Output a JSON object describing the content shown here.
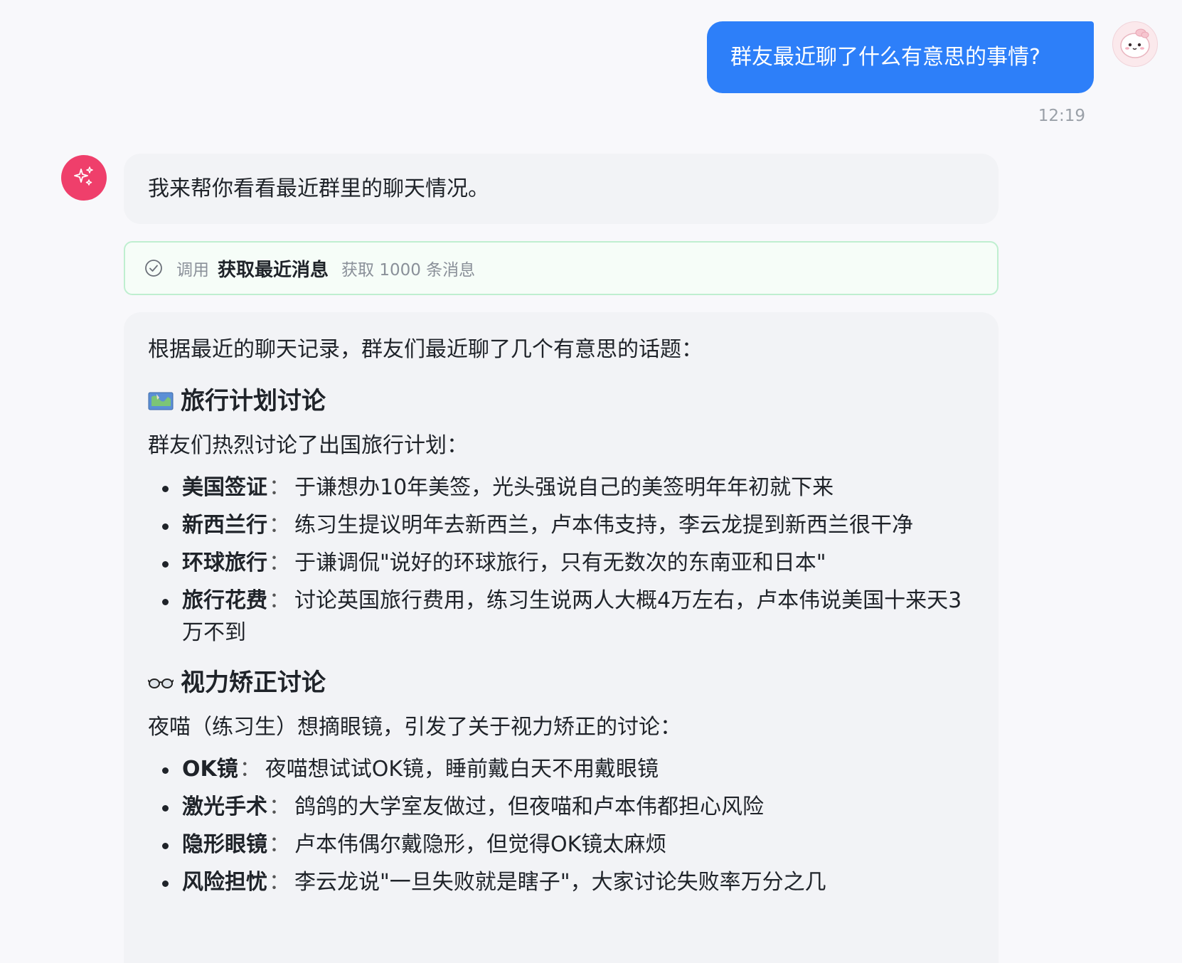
{
  "user_message": {
    "text": "群友最近聊了什么有意思的事情?",
    "time": "12:19",
    "avatar_icon": "bunny-avatar-icon"
  },
  "assistant": {
    "avatar_icon": "sparkle-icon",
    "first_reply": "我来帮你看看最近群里的聊天情况。",
    "tool_call": {
      "status_icon": "check-circle-icon",
      "call_label": "调用",
      "tool_name": "获取最近消息",
      "description": "获取 1000 条消息"
    },
    "answer": {
      "intro": "根据最近的聊天记录，群友们最近聊了几个有意思的话题：",
      "sections": [
        {
          "emoji": "map-emoji-icon",
          "title": "旅行计划讨论",
          "lead": "群友们热烈讨论了出国旅行计划：",
          "items": [
            {
              "term": "美国签证",
              "sep": "：",
              "text": "于谦想办10年美签，光头强说自己的美签明年年初就下来"
            },
            {
              "term": "新西兰行",
              "sep": "：",
              "text": "练习生提议明年去新西兰，卢本伟支持，李云龙提到新西兰很干净"
            },
            {
              "term": "环球旅行",
              "sep": "：",
              "text": "于谦调侃\"说好的环球旅行，只有无数次的东南亚和日本\""
            },
            {
              "term": "旅行花费",
              "sep": "：",
              "text": "讨论英国旅行费用，练习生说两人大概4万左右，卢本伟说美国十来天3万不到"
            }
          ]
        },
        {
          "emoji": "glasses-emoji-icon",
          "title": "视力矫正讨论",
          "lead": "夜喵（练习生）想摘眼镜，引发了关于视力矫正的讨论：",
          "items": [
            {
              "term": "OK镜",
              "sep": "：",
              "text": "夜喵想试试OK镜，睡前戴白天不用戴眼镜"
            },
            {
              "term": "激光手术",
              "sep": "：",
              "text": "鸽鸽的大学室友做过，但夜喵和卢本伟都担心风险"
            },
            {
              "term": "隐形眼镜",
              "sep": "：",
              "text": "卢本伟偶尔戴隐形，但觉得OK镜太麻烦"
            },
            {
              "term": "风险担忧",
              "sep": "：",
              "text": "李云龙说\"一旦失败就是瞎子\"，大家讨论失败率万分之几"
            }
          ]
        }
      ]
    }
  },
  "colors": {
    "user_bubble": "#2d7ff9",
    "bot_avatar": "#ef3f6b",
    "tool_card_border": "#bfefd0",
    "background": "#f8f8fb"
  }
}
